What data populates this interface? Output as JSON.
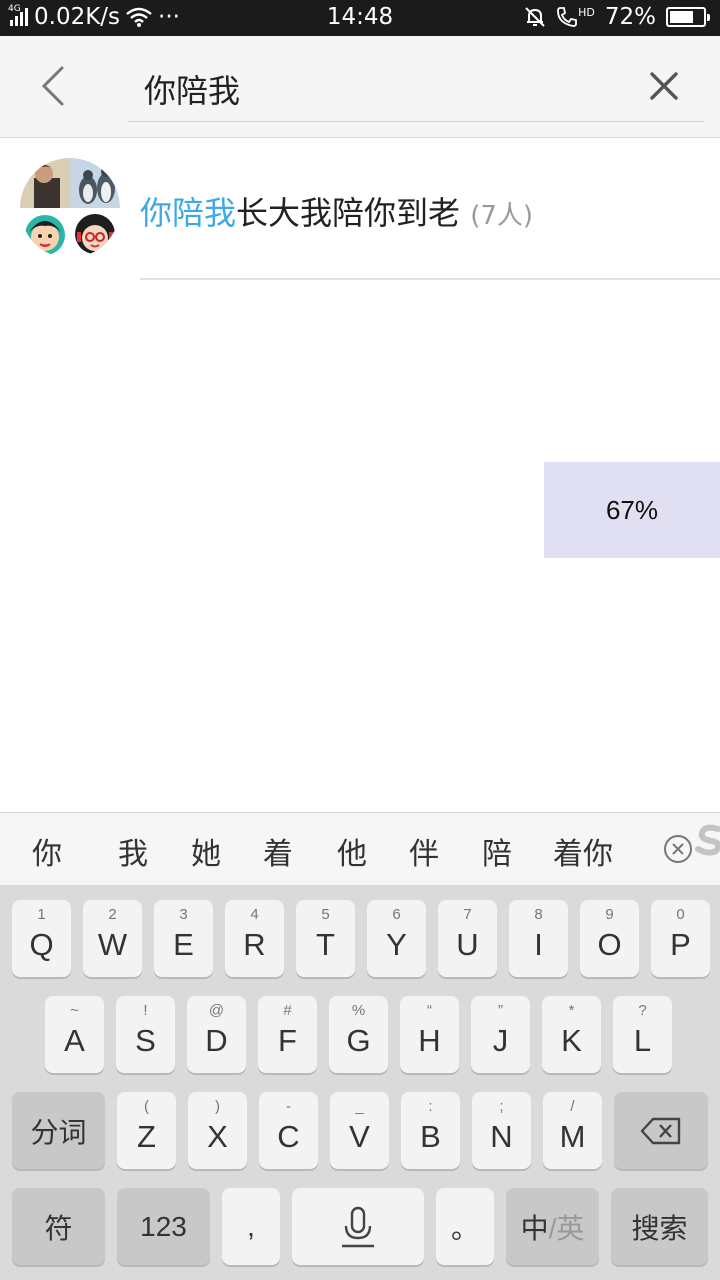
{
  "status_bar": {
    "network": "4G",
    "speed": "0.02K/s",
    "dots": "···",
    "time": "14:48",
    "hd": "HD",
    "battery": "72%",
    "battery_level": 0.72
  },
  "search": {
    "query": "你陪我"
  },
  "result": {
    "highlight": "你陪我",
    "rest": "长大我陪你到老",
    "count": "(7人)"
  },
  "progress": {
    "label": "67%"
  },
  "candidates": [
    "你",
    "我",
    "她",
    "着",
    "他",
    "伴",
    "陪",
    "着你"
  ],
  "keyboard": {
    "row1": [
      {
        "main": "Q",
        "sub": "1"
      },
      {
        "main": "W",
        "sub": "2"
      },
      {
        "main": "E",
        "sub": "3"
      },
      {
        "main": "R",
        "sub": "4"
      },
      {
        "main": "T",
        "sub": "5"
      },
      {
        "main": "Y",
        "sub": "6"
      },
      {
        "main": "U",
        "sub": "7"
      },
      {
        "main": "I",
        "sub": "8"
      },
      {
        "main": "O",
        "sub": "9"
      },
      {
        "main": "P",
        "sub": "0"
      }
    ],
    "row2": [
      {
        "main": "A",
        "sub": "~"
      },
      {
        "main": "S",
        "sub": "!"
      },
      {
        "main": "D",
        "sub": "@"
      },
      {
        "main": "F",
        "sub": "#"
      },
      {
        "main": "G",
        "sub": "%"
      },
      {
        "main": "H",
        "sub": "“"
      },
      {
        "main": "J",
        "sub": "”"
      },
      {
        "main": "K",
        "sub": "*"
      },
      {
        "main": "L",
        "sub": "?"
      }
    ],
    "row3": [
      {
        "main": "Z",
        "sub": "("
      },
      {
        "main": "X",
        "sub": ")"
      },
      {
        "main": "C",
        "sub": "-"
      },
      {
        "main": "V",
        "sub": "_"
      },
      {
        "main": "B",
        "sub": ":"
      },
      {
        "main": "N",
        "sub": ";"
      },
      {
        "main": "M",
        "sub": "/"
      }
    ],
    "segment_label": "分词",
    "symbol_label": "符",
    "number_label": "123",
    "comma_label": ",",
    "period_label": "。",
    "lang_cn": "中",
    "lang_sep": "/",
    "lang_en": "英",
    "search_label": "搜索"
  },
  "colors": {
    "highlight": "#3ea8ea",
    "progress_bg": "#e1dff2",
    "keyboard_bg": "#dadada"
  }
}
